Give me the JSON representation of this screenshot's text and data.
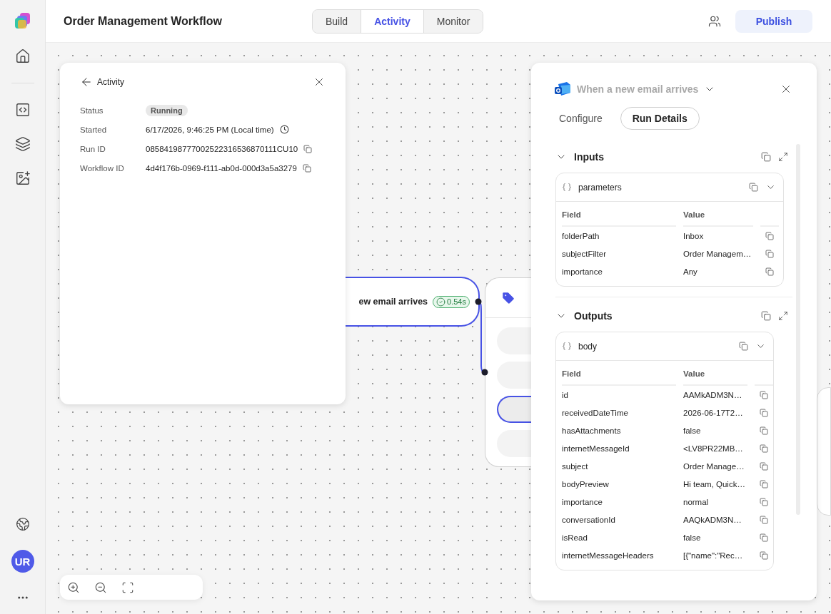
{
  "sidebar": {
    "avatar": "UR"
  },
  "header": {
    "title": "Order Management Workflow",
    "tabs": [
      {
        "label": "Build",
        "selected": false
      },
      {
        "label": "Activity",
        "selected": true
      },
      {
        "label": "Monitor",
        "selected": false
      }
    ],
    "publish": "Publish"
  },
  "activity": {
    "title": "Activity",
    "fields": [
      {
        "label": "Status",
        "value": "Running",
        "kind": "badge"
      },
      {
        "label": "Started",
        "value": "6/17/2026, 9:46:25 PM (Local time)",
        "kind": "time"
      },
      {
        "label": "Run ID",
        "value": "08584198777002522316536870111CU10",
        "kind": "copy"
      },
      {
        "label": "Workflow ID",
        "value": "4d4f176b-0969-f111-ab0d-000d3a5a3279",
        "kind": "copy"
      }
    ]
  },
  "canvas": {
    "trigger": {
      "label": "ew email arrives",
      "duration": "0.54s",
      "selected": true
    },
    "action": {
      "rows": [
        {
          "selected": false
        },
        {
          "selected": false
        },
        {
          "selected": true
        },
        {
          "selected": false
        }
      ]
    }
  },
  "panel": {
    "title": "When a new email arrives",
    "tabs": [
      {
        "label": "Configure",
        "selected": false
      },
      {
        "label": "Run Details",
        "selected": true
      }
    ],
    "sections": [
      {
        "title": "Inputs",
        "expanded": true,
        "object": "parameters",
        "columns": [
          "Field",
          "Value"
        ],
        "rows": [
          {
            "field": "folderPath",
            "value": "Inbox"
          },
          {
            "field": "subjectFilter",
            "value": "Order Managem…"
          },
          {
            "field": "importance",
            "value": "Any"
          }
        ]
      },
      {
        "title": "Outputs",
        "expanded": true,
        "object": "body",
        "columns": [
          "Field",
          "Value"
        ],
        "rows": [
          {
            "field": "id",
            "value": "AAMkADM3N…"
          },
          {
            "field": "receivedDateTime",
            "value": "2026-06-17T2…"
          },
          {
            "field": "hasAttachments",
            "value": "false"
          },
          {
            "field": "internetMessageId",
            "value": "<LV8PR22MB…"
          },
          {
            "field": "subject",
            "value": "Order Manage…"
          },
          {
            "field": "bodyPreview",
            "value": "Hi team, Quick…"
          },
          {
            "field": "importance",
            "value": "normal"
          },
          {
            "field": "conversationId",
            "value": "AAQkADM3N…"
          },
          {
            "field": "isRead",
            "value": "false"
          },
          {
            "field": "internetMessageHeaders",
            "value": "[{\"name\":\"Rec…"
          }
        ]
      }
    ]
  }
}
